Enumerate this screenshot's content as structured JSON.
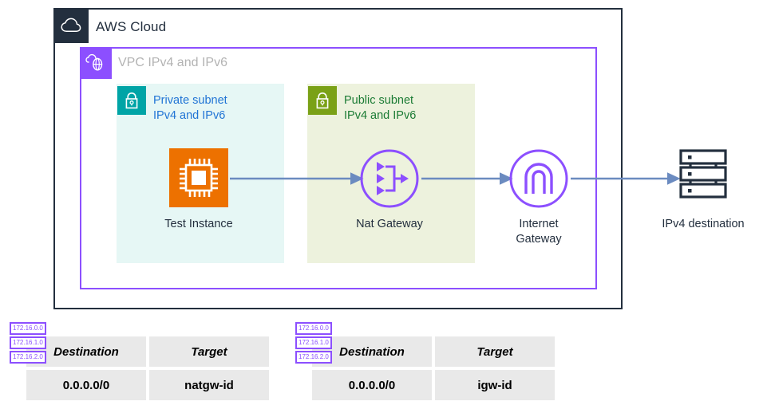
{
  "diagram": {
    "cloud": {
      "label": "AWS Cloud",
      "icon": "aws-cloud-icon",
      "border_color": "#232F3E"
    },
    "vpc": {
      "label": "VPC IPv4 and IPv6",
      "icon": "vpc-icon",
      "border_color": "#8C4FFF"
    },
    "subnets": [
      {
        "id": "private",
        "label": "Private subnet\nIPv4 and IPv6",
        "icon": "lock-icon",
        "icon_color": "#00A4A6",
        "text_color": "#2074D5",
        "fill": "#E6F7F5"
      },
      {
        "id": "public",
        "label": "Public subnet\nIPv4 and IPv6",
        "icon": "lock-icon",
        "icon_color": "#7AA116",
        "text_color": "#1B7B34",
        "fill": "#EDF2DD"
      }
    ],
    "nodes": [
      {
        "id": "test-instance",
        "label": "Test Instance",
        "icon": "ec2-instance-icon",
        "color": "#ED7100"
      },
      {
        "id": "nat-gateway",
        "label": "Nat Gateway",
        "icon": "nat-gateway-icon",
        "color": "#8C4FFF"
      },
      {
        "id": "internet-gateway",
        "label": "Internet\nGateway",
        "icon": "internet-gateway-icon",
        "color": "#8C4FFF"
      },
      {
        "id": "ipv4-destination",
        "label": "IPv4 destination",
        "icon": "server-stack-icon",
        "color": "#232F3E"
      }
    ],
    "connector_color": "#6B8BC0"
  },
  "route_tables": [
    {
      "id": "private-route-table",
      "headers": [
        "Destination",
        "Target"
      ],
      "rows": [
        [
          "0.0.0.0/0",
          "natgw-id"
        ]
      ],
      "cidr_badges": [
        "172.16.0.0",
        "172.16.1.0",
        "172.16.2.0"
      ]
    },
    {
      "id": "public-route-table",
      "headers": [
        "Destination",
        "Target"
      ],
      "rows": [
        [
          "0.0.0.0/0",
          "igw-id"
        ]
      ],
      "cidr_badges": [
        "172.16.0.0",
        "172.16.1.0",
        "172.16.2.0"
      ]
    }
  ]
}
